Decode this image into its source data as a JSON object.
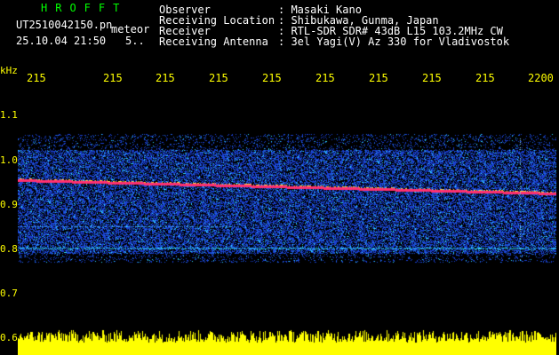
{
  "header": {
    "logo": "HROFFT",
    "filename": "UT2510042150.pn",
    "mode": "meteor",
    "datetime": "25.10.04 21:50",
    "interval": "5..",
    "fields": [
      {
        "label": "Observer",
        "value": ": Masaki Kano"
      },
      {
        "label": "Receiving Location",
        "value": ": Shibukawa, Gunma, Japan"
      },
      {
        "label": "Receiver",
        "value": ": RTL-SDR SDR# 43dB L15 103.2MHz CW"
      },
      {
        "label": "Receiving Antenna",
        "value": ": 3el Yagi(V) Az 330 for Vladivostok"
      }
    ]
  },
  "axes": {
    "freq_unit": "kHz",
    "freq_ticks": [
      "1.1",
      "1.0",
      "0.9",
      "0.8",
      "0.7",
      "0.6"
    ],
    "time_ticks": [
      "215",
      "215",
      "215",
      "215",
      "215",
      "215",
      "215",
      "215",
      "215",
      "2200"
    ]
  },
  "colors": {
    "text": "#ffffff",
    "axis": "#ffff00",
    "logo": "#00ff00",
    "carrier": "#ff3070",
    "noise": "#1a3fd0",
    "noise_bright": "#30d8ff",
    "level": "#ffff00"
  }
}
